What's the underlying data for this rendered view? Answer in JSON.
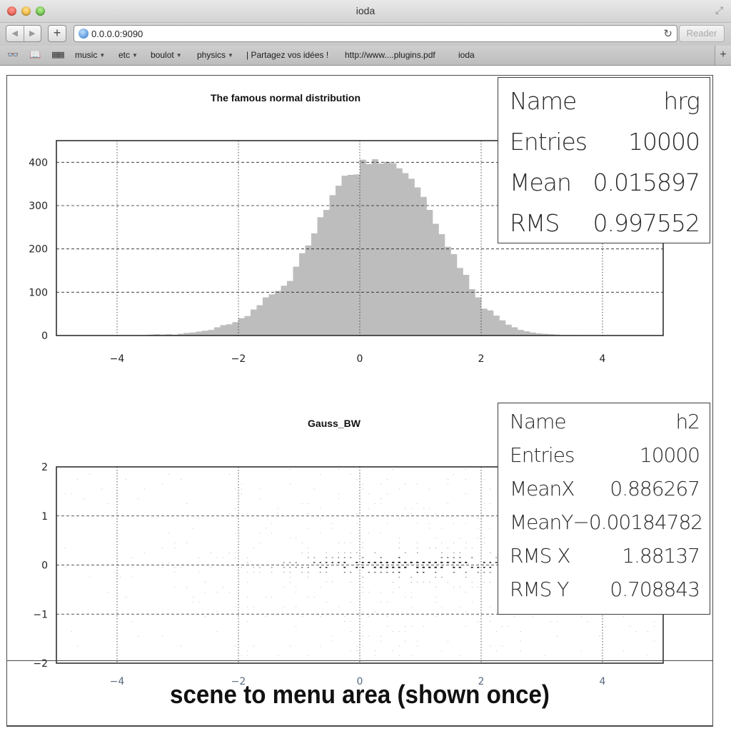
{
  "window": {
    "title": "ioda"
  },
  "toolbar": {
    "back_icon": "back-arrow-icon",
    "forward_icon": "forward-arrow-icon",
    "add_icon": "plus-icon",
    "url": "0.0.0.0:9090",
    "reader_label": "Reader"
  },
  "bookmarks": {
    "items": [
      {
        "label": "music",
        "has_menu": true
      },
      {
        "label": "etc",
        "has_menu": true
      },
      {
        "label": "boulot",
        "has_menu": true
      },
      {
        "label": "physics",
        "has_menu": true
      },
      {
        "label": "| Partagez vos idées !",
        "has_menu": false
      },
      {
        "label": "http://www....plugins.pdf",
        "has_menu": false
      },
      {
        "label": "ioda",
        "has_menu": false
      }
    ]
  },
  "chart_data": [
    {
      "type": "bar",
      "title": "The famous normal distribution",
      "xlim": [
        -5,
        5
      ],
      "ylim": [
        0,
        450
      ],
      "xticks": [
        "−4",
        "−2",
        "0",
        "2",
        "4"
      ],
      "yticks": [
        "0",
        "100",
        "200",
        "300",
        "400"
      ],
      "grid": true,
      "bin_start": -5,
      "bin_width": 0.1,
      "values": [
        0,
        0,
        0,
        0,
        0,
        0,
        0,
        0,
        0,
        0,
        0,
        0,
        0,
        0,
        1,
        2,
        3,
        2,
        3,
        2,
        4,
        6,
        7,
        9,
        11,
        13,
        19,
        24,
        26,
        31,
        40,
        45,
        60,
        70,
        88,
        95,
        103,
        115,
        126,
        159,
        190,
        208,
        236,
        273,
        290,
        324,
        346,
        369,
        371,
        372,
        406,
        396,
        407,
        397,
        401,
        398,
        386,
        375,
        362,
        342,
        320,
        290,
        258,
        234,
        205,
        188,
        156,
        140,
        107,
        88,
        62,
        58,
        46,
        35,
        25,
        19,
        13,
        10,
        7,
        5,
        4,
        3,
        2,
        1,
        1,
        1,
        0,
        0,
        0,
        0,
        0,
        0,
        0,
        0,
        0,
        0,
        0,
        0,
        0,
        0
      ],
      "stats": {
        "rows": [
          {
            "label": "Name",
            "value": "hrg"
          },
          {
            "label": "Entries",
            "value": "10000"
          },
          {
            "label": "Mean",
            "value": "0.015897"
          },
          {
            "label": "RMS",
            "value": "0.997552"
          }
        ]
      }
    },
    {
      "type": "heatmap",
      "title": "Gauss_BW",
      "xlim": [
        -5,
        5
      ],
      "ylim": [
        -2,
        2
      ],
      "xticks": [
        "−4",
        "−2",
        "0",
        "2",
        "4"
      ],
      "yticks": [
        "−2",
        "−1",
        "0",
        "1",
        "2"
      ],
      "grid": true,
      "stats": {
        "rows": [
          {
            "label": "Name",
            "value": "h2"
          },
          {
            "label": "Entries",
            "value": "10000"
          },
          {
            "label": "MeanX",
            "value": "0.886267"
          },
          {
            "label": "MeanY",
            "value": "−0.00184782"
          },
          {
            "label": "RMS X",
            "value": "1.88137"
          },
          {
            "label": "RMS Y",
            "value": "0.708843"
          }
        ]
      }
    }
  ],
  "menu_area": {
    "label": "scene to menu area (shown once)"
  }
}
